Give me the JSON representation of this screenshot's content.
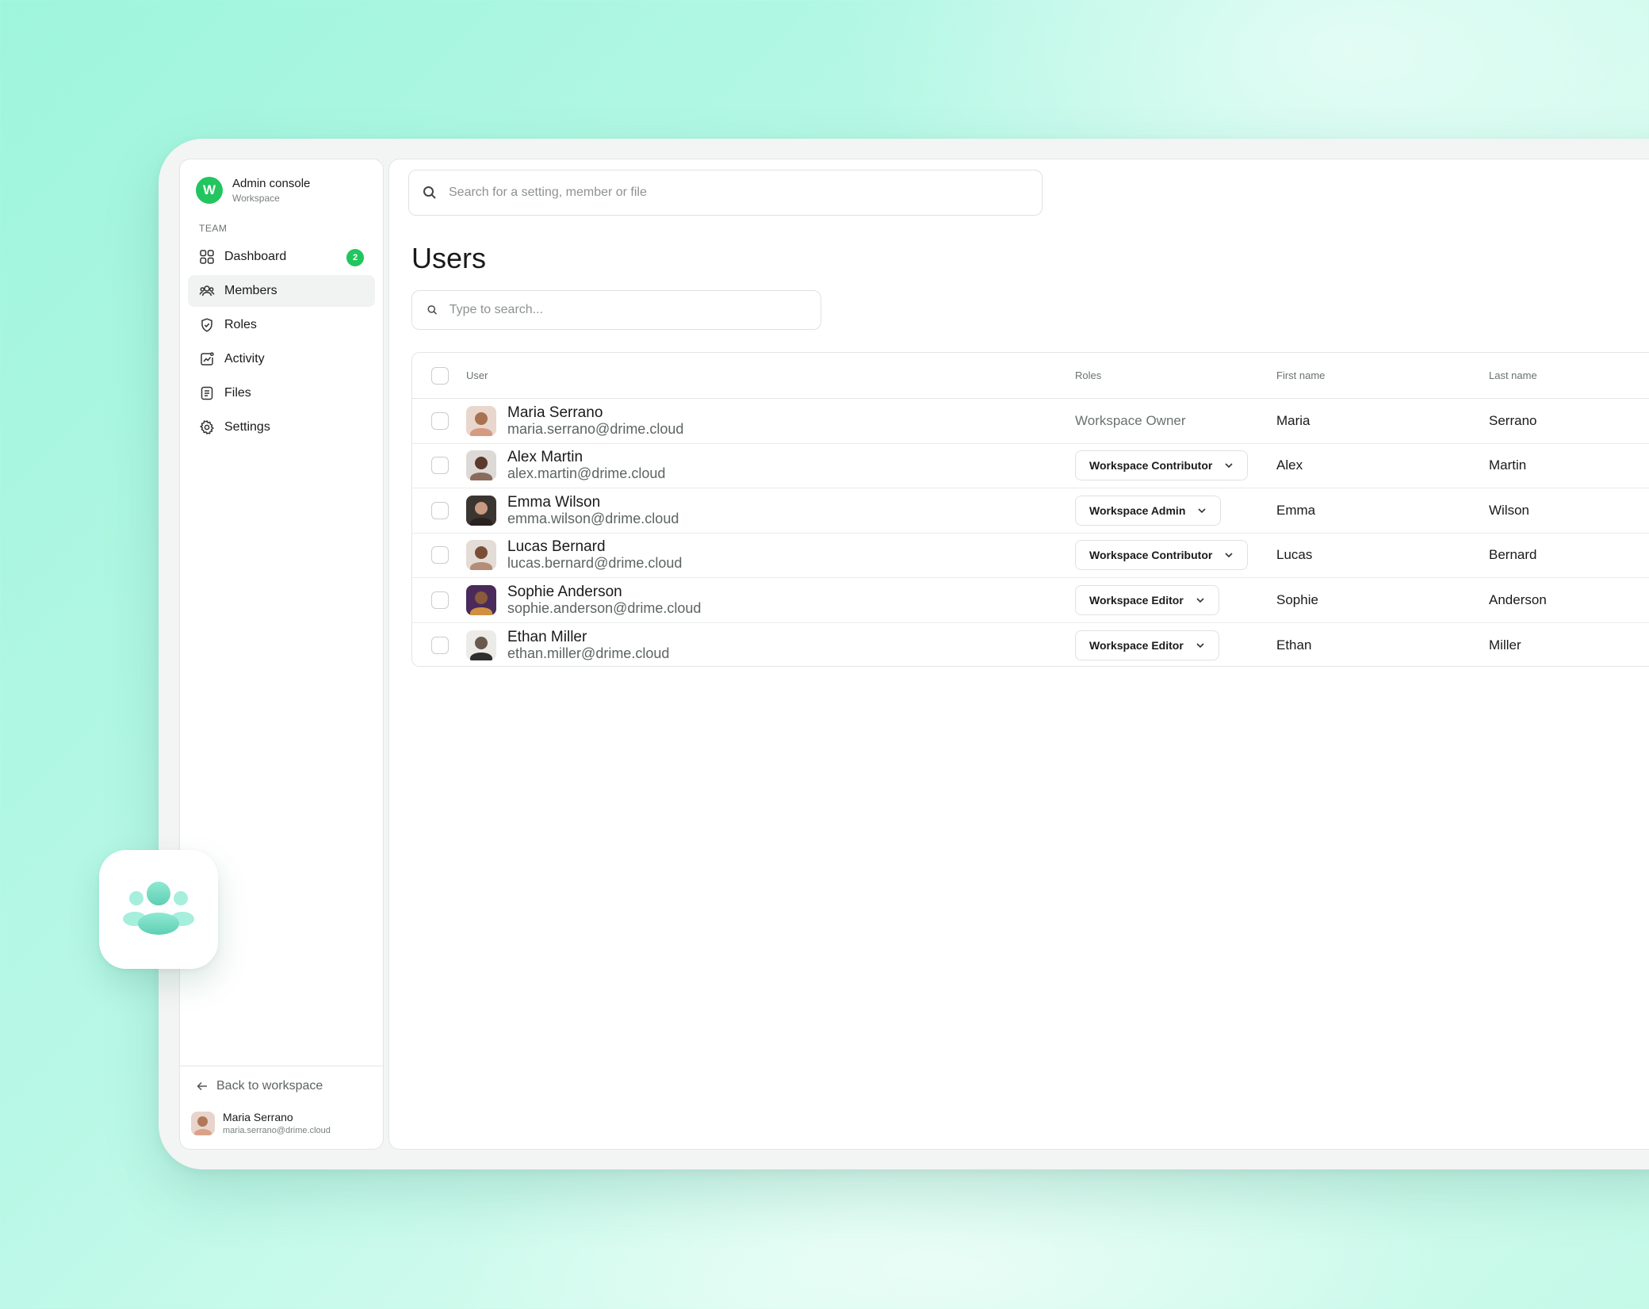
{
  "brand": {
    "logo_letter": "W",
    "title": "Admin console",
    "subtitle": "Workspace",
    "color": "#22c55e"
  },
  "sidebar": {
    "section_label": "TEAM",
    "items": [
      {
        "label": "Dashboard",
        "icon": "grid-icon",
        "badge": "2"
      },
      {
        "label": "Members",
        "icon": "users-icon",
        "active": true
      },
      {
        "label": "Roles",
        "icon": "shield-icon"
      },
      {
        "label": "Activity",
        "icon": "activity-icon"
      },
      {
        "label": "Files",
        "icon": "file-icon"
      },
      {
        "label": "Settings",
        "icon": "gear-icon"
      }
    ],
    "back_label": "Back to workspace",
    "current_user": {
      "name": "Maria Serrano",
      "email": "maria.serrano@drime.cloud"
    }
  },
  "search": {
    "placeholder": "Search for a setting, member or file"
  },
  "page": {
    "title": "Users",
    "search_placeholder": "Type to search..."
  },
  "table": {
    "headers": {
      "user": "User",
      "roles": "Roles",
      "first_name": "First name",
      "last_name": "Last name"
    },
    "rows": [
      {
        "name": "Maria Serrano",
        "email": "maria.serrano@drime.cloud",
        "role": "Workspace Owner",
        "role_editable": false,
        "first": "Maria",
        "last": "Serrano"
      },
      {
        "name": "Alex Martin",
        "email": "alex.martin@drime.cloud",
        "role": "Workspace Contributor",
        "role_editable": true,
        "first": "Alex",
        "last": "Martin"
      },
      {
        "name": "Emma Wilson",
        "email": "emma.wilson@drime.cloud",
        "role": "Workspace Admin",
        "role_editable": true,
        "first": "Emma",
        "last": "Wilson"
      },
      {
        "name": "Lucas Bernard",
        "email": "lucas.bernard@drime.cloud",
        "role": "Workspace Contributor",
        "role_editable": true,
        "first": "Lucas",
        "last": "Bernard"
      },
      {
        "name": "Sophie Anderson",
        "email": "sophie.anderson@drime.cloud",
        "role": "Workspace Editor",
        "role_editable": true,
        "first": "Sophie",
        "last": "Anderson"
      },
      {
        "name": "Ethan Miller",
        "email": "ethan.miller@drime.cloud",
        "role": "Workspace Editor",
        "role_editable": true,
        "first": "Ethan",
        "last": "Miller"
      }
    ]
  },
  "colors": {
    "accent": "#22c55e",
    "background_mint": "#a9f6df",
    "floating_icon": "#7fe0c9"
  }
}
